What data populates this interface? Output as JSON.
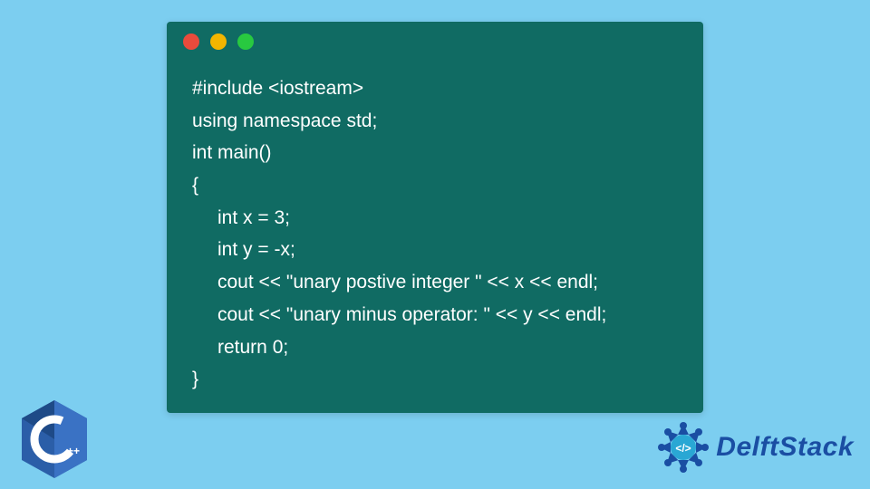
{
  "code": {
    "lines": [
      "#include <iostream>",
      "using namespace std;",
      "int main()",
      "{",
      "int x = 3;",
      "int y = -x;",
      "cout << \"unary postive integer \" << x << endl;",
      "cout << \"unary minus operator: \" << y << endl;",
      "return 0;",
      "}"
    ]
  },
  "logos": {
    "cpp_label": "C++",
    "delft_label": "DelftStack"
  },
  "colors": {
    "bg": "#7ccef0",
    "window": "#106b63",
    "text": "#ffffff",
    "cpp_blue": "#2b5ea8",
    "delft_blue": "#1a4ea3"
  }
}
